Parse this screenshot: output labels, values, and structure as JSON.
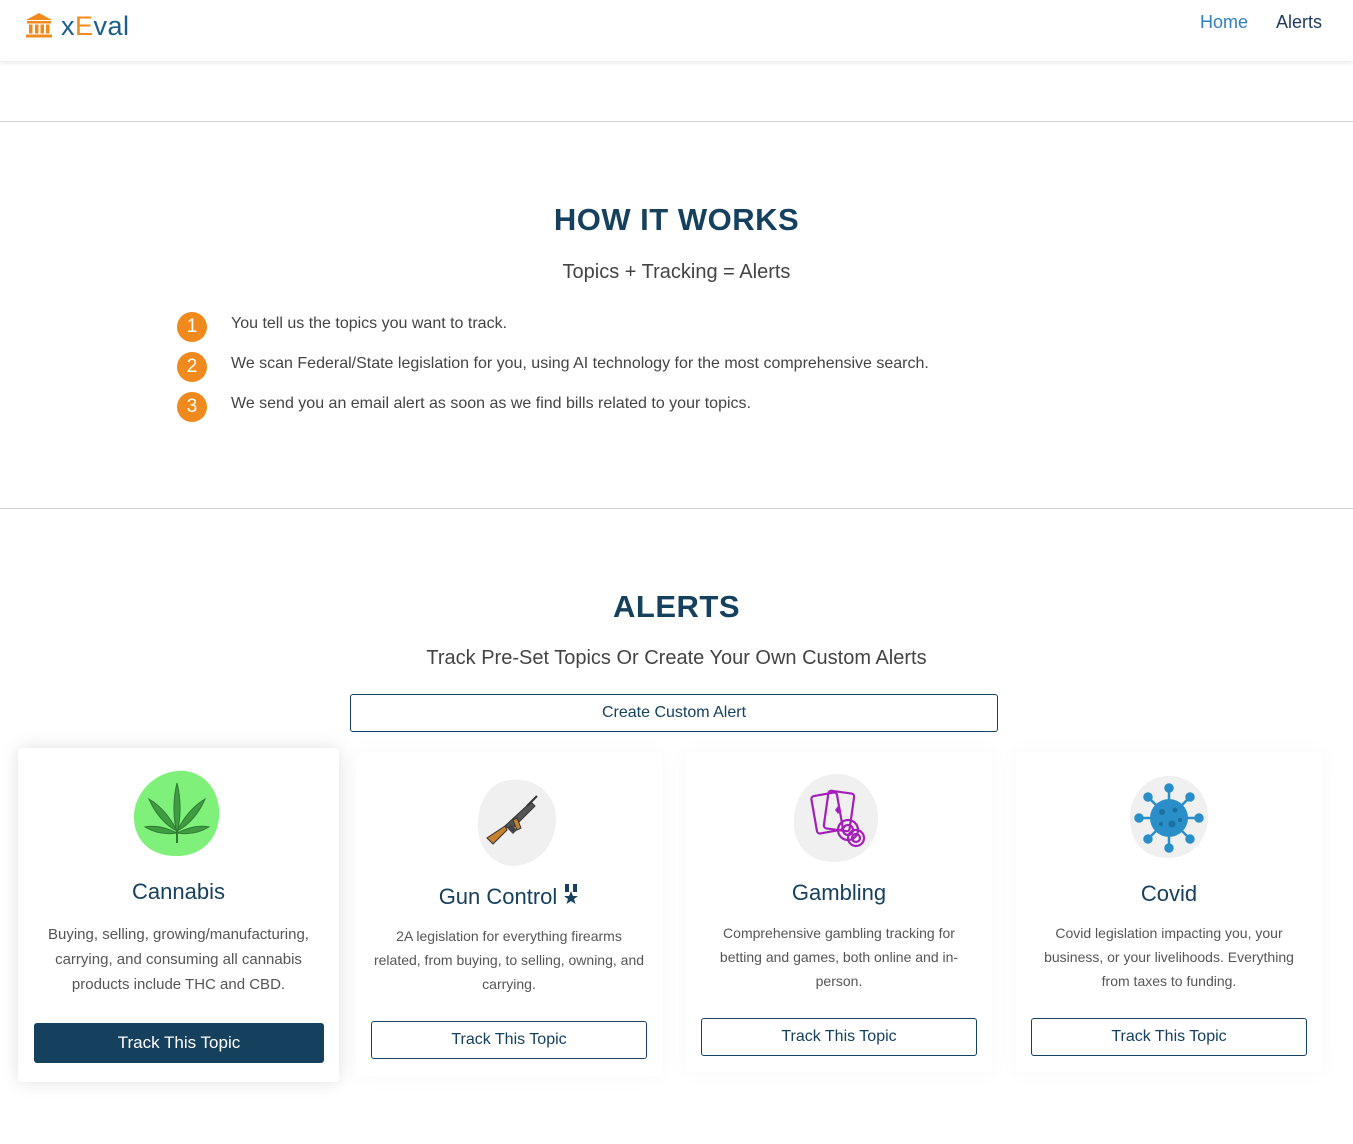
{
  "header": {
    "logo_prefix": "x",
    "logo_e": "E",
    "logo_suffix": "val",
    "nav": {
      "home": "Home",
      "alerts": "Alerts"
    }
  },
  "how_it_works": {
    "title": "HOW IT WORKS",
    "subtitle": "Topics + Tracking = Alerts",
    "steps": [
      {
        "num": "1",
        "text": "You tell us the topics you want to track."
      },
      {
        "num": "2",
        "text": "We scan Federal/State legislation for you, using AI technology for the most comprehensive search."
      },
      {
        "num": "3",
        "text": "We send you an email alert as soon as we find bills related to your topics."
      }
    ]
  },
  "alerts": {
    "title": "ALERTS",
    "subtitle": "Track Pre-Set Topics Or Create Your Own Custom Alerts",
    "create_button": "Create Custom Alert",
    "cards": [
      {
        "title": "Cannabis",
        "icon": "cannabis-leaf-icon",
        "description": "Buying, selling, growing/manufacturing, carrying, and consuming all cannabis products include THC and CBD.",
        "button": "Track This Topic"
      },
      {
        "title": "Gun Control",
        "icon": "rifle-icon",
        "badge_icon": "medal-icon",
        "description": "2A legislation for everything firearms related, from buying, to selling, owning, and carrying.",
        "button": "Track This Topic"
      },
      {
        "title": "Gambling",
        "icon": "cards-chips-icon",
        "description": "Comprehensive gambling tracking for betting and games, both online and in-person.",
        "button": "Track This Topic"
      },
      {
        "title": "Covid",
        "icon": "virus-icon",
        "description": "Covid legislation impacting you, your business, or your livelihoods. Everything from taxes to funding.",
        "button": "Track This Topic"
      }
    ]
  },
  "colors": {
    "navy": "#15405e",
    "orange": "#f08a1c",
    "link_blue": "#2f7fc1",
    "cannabis_green": "#7ff07a",
    "gambling_purple": "#a41fb8",
    "virus_blue": "#2a8fc8"
  }
}
